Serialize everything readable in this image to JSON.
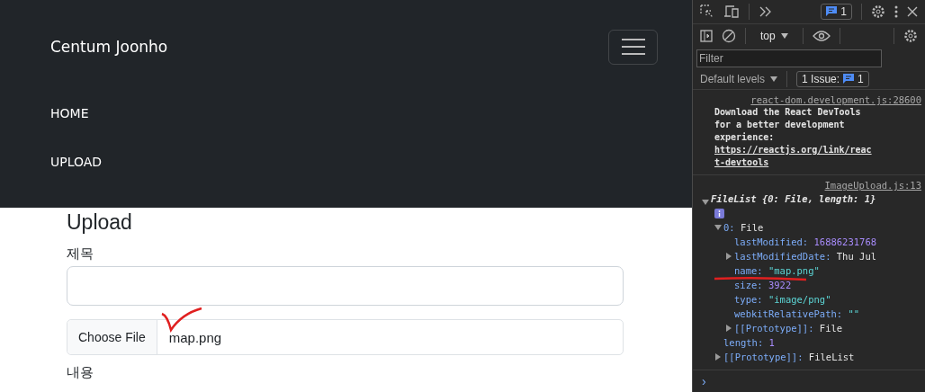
{
  "navbar": {
    "brand": "Centum Joonho",
    "links": [
      {
        "label": "HOME"
      },
      {
        "label": "UPLOAD"
      }
    ]
  },
  "form": {
    "heading": "Upload",
    "fields": [
      {
        "kind": "text",
        "label": "제목"
      },
      {
        "kind": "file",
        "button": "Choose File",
        "value": "map.png"
      },
      {
        "kind": "heading",
        "label": "내용"
      }
    ]
  },
  "devtools": {
    "issues_count": "1",
    "context": "top",
    "filter": {
      "placeholder": "Filter"
    },
    "levels": "Default levels",
    "issues_label": "1 Issue:",
    "issues_badge": "1",
    "messages": [
      {
        "source": "react-dom.development.js:28600",
        "text": "Download the React DevTools for a better development experience: ",
        "link": "https://reactjs.org/link/react-devtools"
      },
      {
        "source": "ImageUpload.js:13",
        "tree": {
          "label": "FileList",
          "summary": "{0: File, length: 1}",
          "expanded": true,
          "children": [
            {
              "key": "0:",
              "value": "File",
              "kind": "object",
              "expanded": true,
              "children": [
                {
                  "key": "lastModified:",
                  "value": "16886231768",
                  "kind": "number"
                },
                {
                  "key": "lastModifiedDate:",
                  "value": "Thu Jul",
                  "kind": "object",
                  "expanded": false
                },
                {
                  "key": "name:",
                  "value": "\"map.png\"",
                  "kind": "string",
                  "underlined": true
                },
                {
                  "key": "size:",
                  "value": "3922",
                  "kind": "number"
                },
                {
                  "key": "type:",
                  "value": "\"image/png\"",
                  "kind": "string"
                },
                {
                  "key": "webkitRelativePath:",
                  "value": "\"\"",
                  "kind": "string"
                },
                {
                  "key": "[[Prototype]]:",
                  "value": "File",
                  "kind": "object",
                  "expanded": false
                }
              ]
            },
            {
              "key": "length:",
              "value": "1",
              "kind": "number"
            },
            {
              "key": "[[Prototype]]:",
              "value": "FileList",
              "kind": "object",
              "expanded": false
            }
          ]
        }
      }
    ],
    "prompt": "›"
  }
}
